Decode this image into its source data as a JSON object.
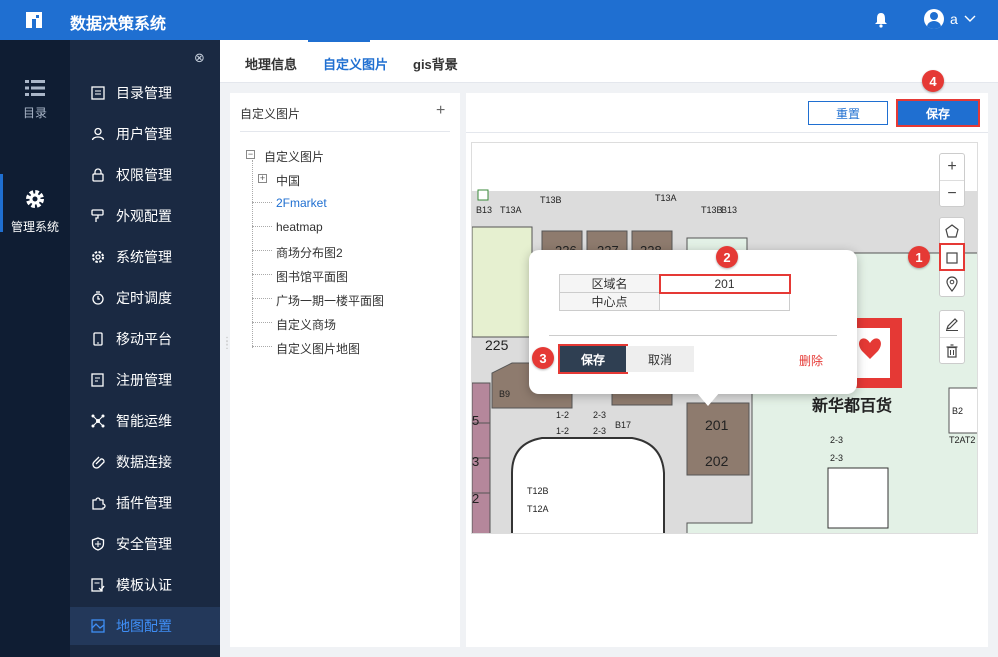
{
  "app": {
    "title": "数据决策系统",
    "user": "a"
  },
  "rail": {
    "items": [
      {
        "label": "目录"
      },
      {
        "label": "管理系统"
      }
    ]
  },
  "sidebar": {
    "items": [
      {
        "label": "目录管理"
      },
      {
        "label": "用户管理"
      },
      {
        "label": "权限管理"
      },
      {
        "label": "外观配置"
      },
      {
        "label": "系统管理"
      },
      {
        "label": "定时调度"
      },
      {
        "label": "移动平台"
      },
      {
        "label": "注册管理"
      },
      {
        "label": "智能运维"
      },
      {
        "label": "数据连接"
      },
      {
        "label": "插件管理"
      },
      {
        "label": "安全管理"
      },
      {
        "label": "模板认证"
      },
      {
        "label": "地图配置"
      }
    ],
    "active": "地图配置"
  },
  "tabs": [
    {
      "label": "地理信息"
    },
    {
      "label": "自定义图片"
    },
    {
      "label": "gis背景"
    }
  ],
  "tree": {
    "header": "自定义图片",
    "add": "+",
    "root": "自定义图片",
    "nodes": [
      {
        "label": "中国"
      },
      {
        "label": "2Fmarket"
      },
      {
        "label": "heatmap"
      },
      {
        "label": "商场分布图2"
      },
      {
        "label": "图书馆平面图"
      },
      {
        "label": "广场一期一楼平面图"
      },
      {
        "label": "自定义商场"
      },
      {
        "label": "自定义图片地图"
      }
    ],
    "selected": "2Fmarket"
  },
  "toolbar": {
    "reset": "重置",
    "save": "保存"
  },
  "popup": {
    "rows": [
      {
        "key": "区域名",
        "value": "201"
      },
      {
        "key": "中心点",
        "value": ""
      }
    ],
    "save": "保存",
    "cancel": "取消",
    "delete": "删除"
  },
  "callouts": [
    "1",
    "2",
    "3",
    "4"
  ],
  "map": {
    "labels": {
      "r226": "226",
      "r227": "227",
      "r228": "228",
      "r225": "225",
      "r201": "201",
      "r202": "202",
      "b13": "B13",
      "t13a_l": "T13A",
      "t13b": "T13B",
      "t13a_r": "T13A",
      "t13b_r": "T13B",
      "b13_r": "B13",
      "b9": "B9",
      "b17": "B17",
      "l12_1": "1-2",
      "l23_1": "2-3",
      "l12_2": "1-2",
      "l23_2": "2-3",
      "t12b": "T12B",
      "t12a": "T12A",
      "store": "新华都百货",
      "b2": "B2",
      "t2at2": "T2AT2",
      "r23a": "2-3",
      "r23b": "2-3",
      "n5": "5",
      "n3": "3",
      "n2": "2"
    }
  },
  "colors": {
    "brand": "#1f6fd1",
    "callout": "#e53935",
    "room": "#8e7b6e"
  }
}
